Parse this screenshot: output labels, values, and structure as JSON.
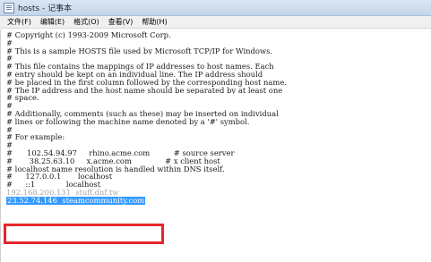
{
  "window": {
    "title": "hosts - 记事本",
    "icon": "notepad-icon"
  },
  "menu": [
    {
      "id": "file",
      "label": "文件(F)"
    },
    {
      "id": "edit",
      "label": "编辑(E)"
    },
    {
      "id": "format",
      "label": "格式(O)"
    },
    {
      "id": "view",
      "label": "查看(V)"
    },
    {
      "id": "help",
      "label": "帮助(H)"
    }
  ],
  "editor": {
    "lines": [
      "# Copyright (c) 1993-2009 Microsoft Corp.",
      "#",
      "# This is a sample HOSTS file used by Microsoft TCP/IP for Windows.",
      "#",
      "# This file contains the mappings of IP addresses to host names. Each",
      "# entry should be kept on an individual line. The IP address should",
      "# be placed in the first column followed by the corresponding host name.",
      "# The IP address and the host name should be separated by at least one",
      "# space.",
      "#",
      "# Additionally, comments (such as these) may be inserted on individual",
      "# lines or following the machine name denoted by a '#' symbol.",
      "#",
      "# For example:",
      "#",
      "#      102.54.94.97     rhino.acme.com          # source server",
      "#       38.25.63.10     x.acme.com              # x client host",
      "# localhost name resolution is handled within DNS itself.",
      "#\t127.0.0.1       localhost",
      "#\t::1             localhost",
      "192.168.200.131  stuff.dnf.tw",
      "23.52.74.146  steamcommunity.com"
    ]
  },
  "highlight": {
    "color": "#e5262c"
  },
  "selection": {
    "color": "#3399ff"
  }
}
